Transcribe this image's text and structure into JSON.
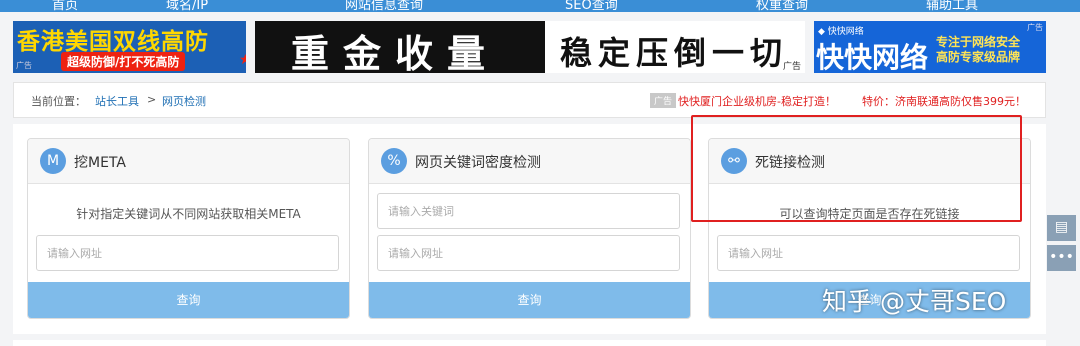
{
  "nav": {
    "items": [
      "首页",
      "域名/IP",
      "网站信息查询",
      "SEO查询",
      "权重查询",
      "辅助工具"
    ]
  },
  "banners": {
    "left": {
      "title": "香港美国双线高防",
      "subtitle": "超级防御/打不死高防",
      "ad": "广告",
      "star": "★"
    },
    "middle": {
      "slogan1": "重金收量",
      "slogan2": "稳定压倒一切",
      "ad": "广告"
    },
    "right": {
      "logo": "◆ 快快网络",
      "title": "快快网络",
      "tagline1": "专注于网络安全",
      "tagline2": "高防专家级品牌",
      "ad": "广告"
    }
  },
  "breadcrumb": {
    "label": "当前位置：",
    "home": "站长工具",
    "separator": ">",
    "current": "网页检测",
    "ad_badge": "广告",
    "ad_text": "快快厦门企业级机房-稳定打造！",
    "promo": "特价：济南联通高防仅售399元！"
  },
  "cards": [
    {
      "icon": "M",
      "icon_name": "meta-icon",
      "title": "挖META",
      "description": "针对指定关键词从不同网站获取相关META",
      "url_placeholder": "请输入网址",
      "button": "查询"
    },
    {
      "icon": "%",
      "icon_name": "percent-icon",
      "title": "网页关键词密度检测",
      "keyword_placeholder": "请输入关键词",
      "url_placeholder": "请输入网址",
      "button": "查询"
    },
    {
      "icon": "⚯",
      "icon_name": "chain-link-icon",
      "title": "死链接检测",
      "description": "可以查询特定页面是否存在死链接",
      "url_placeholder": "请输入网址",
      "button": "查询"
    }
  ],
  "side_buttons": {
    "feedback": "▤",
    "more": "•••"
  },
  "watermark": "知乎 @丈哥SEO",
  "colors": {
    "nav": "#3a8ed6",
    "button": "#7fbbea",
    "link": "#1f6fb4",
    "highlight": "#e02020"
  }
}
